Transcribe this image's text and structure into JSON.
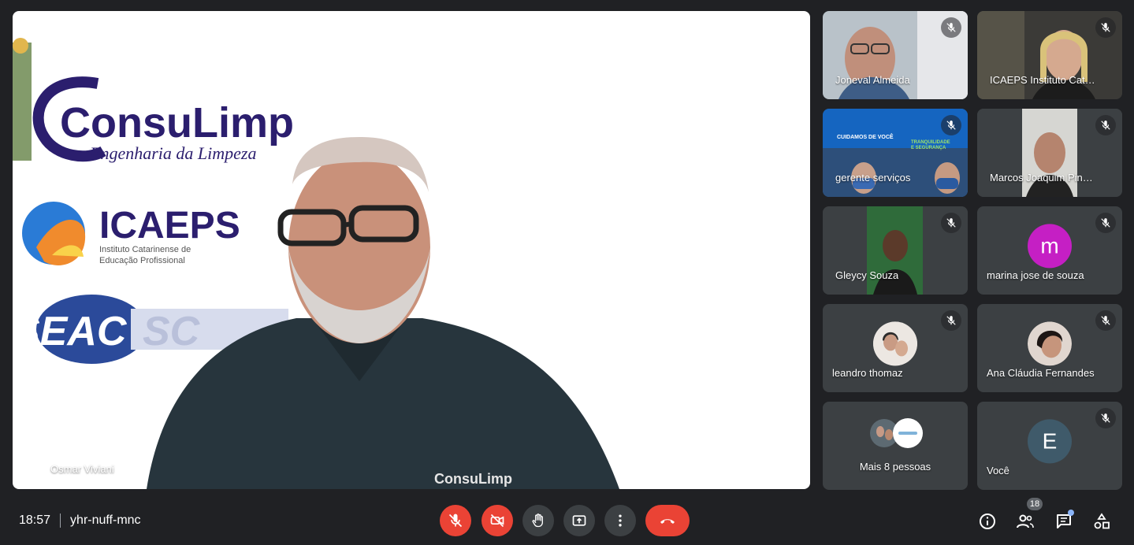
{
  "meeting": {
    "time": "18:57",
    "code": "yhr-nuff-mnc"
  },
  "main_stage": {
    "speaker_name": "Osmar Viviani",
    "logos": {
      "consulimp_title": "ConsuLimp",
      "consulimp_subtitle": "Engenharia da Limpeza",
      "icaeps_title": "ICAEPS",
      "icaeps_subtitle_line1": "Instituto Catarinense de",
      "icaeps_subtitle_line2": "Educação Profissional",
      "seac_title": "SEAC",
      "seac_suffix": "SC",
      "shirt_logo": "ConsuLimp"
    }
  },
  "participants": [
    {
      "name": "Joneval Almeida",
      "muted": true,
      "type": "video"
    },
    {
      "name": "ICAEPS Instituto Cat…",
      "muted": true,
      "type": "video"
    },
    {
      "name": "gerente serviços",
      "muted": true,
      "type": "video",
      "banner_line1": "CUIDAMOS DE VOCÊ",
      "banner_line2": "TRANQUILIDADE",
      "banner_line3": "E SEGURANÇA"
    },
    {
      "name": "Marcos Joaquim Pin…",
      "muted": true,
      "type": "video"
    },
    {
      "name": "Gleycy Souza",
      "muted": true,
      "type": "video"
    },
    {
      "name": "marina jose de souza",
      "muted": true,
      "type": "avatar",
      "initial": "m",
      "avatar_color": "#c51fc4"
    },
    {
      "name": "leandro thomaz",
      "muted": true,
      "type": "photo-avatar"
    },
    {
      "name": "Ana Cláudia Fernandes",
      "muted": true,
      "type": "photo-avatar"
    },
    {
      "name": "Mais 8 pessoas",
      "muted": false,
      "type": "group"
    },
    {
      "name": "Você",
      "muted": true,
      "type": "avatar",
      "initial": "E",
      "avatar_color": "#3f5a6a"
    }
  ],
  "controls": {
    "participants_count": "18"
  },
  "colors": {
    "background": "#202124",
    "danger": "#ea4335",
    "control_grey": "#3c4043"
  }
}
